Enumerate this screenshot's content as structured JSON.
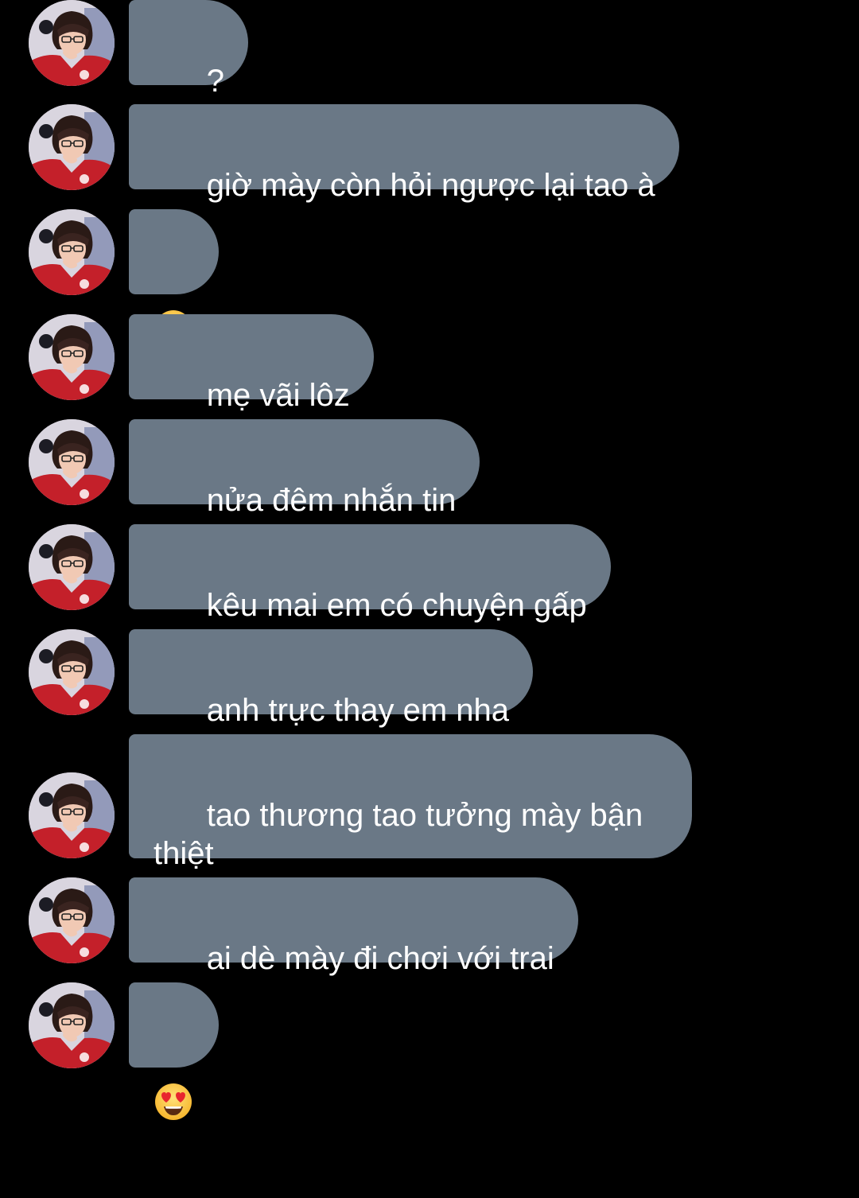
{
  "messages": [
    {
      "id": "m1",
      "text": "?"
    },
    {
      "id": "m2",
      "text": "giờ mày còn hỏi ngược lại tao à"
    },
    {
      "id": "m3",
      "text": "",
      "emoji": "slightly-smiling-face"
    },
    {
      "id": "m4",
      "text": "mẹ vãi lôz"
    },
    {
      "id": "m5",
      "text": "nửa đêm nhắn tin"
    },
    {
      "id": "m6",
      "text": "kêu mai em có chuyện gấp"
    },
    {
      "id": "m7",
      "text": "anh trực thay em nha"
    },
    {
      "id": "m8",
      "text": "tao thương tao tưởng mày bận\nthiệt"
    },
    {
      "id": "m9",
      "text": "ai dè mày đi chơi với trai"
    },
    {
      "id": "m10",
      "text": "",
      "emoji": "smiling-face-with-heart-eyes"
    }
  ],
  "colors": {
    "background": "#000000",
    "bubble": "#6a7886",
    "text": "#ffffff"
  }
}
